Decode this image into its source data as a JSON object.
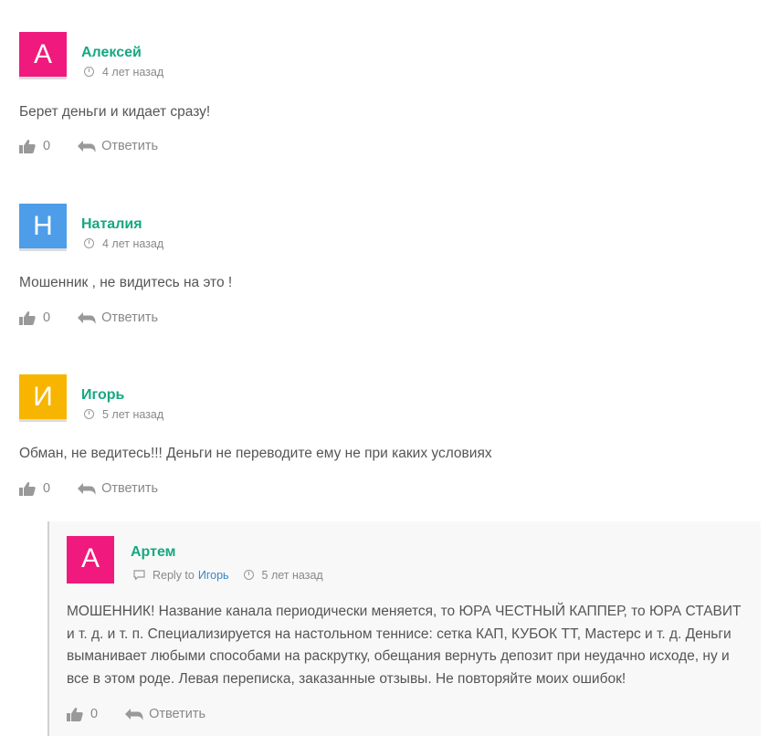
{
  "comments": [
    {
      "avatar_letter": "А",
      "avatar_color": "#f0197d",
      "author": "Алексей",
      "time": "4 лет назад",
      "text": "Берет деньги и кидает сразу!",
      "likes": "0",
      "reply_label": "Ответить"
    },
    {
      "avatar_letter": "Н",
      "avatar_color": "#4d9de8",
      "author": "Наталия",
      "time": "4 лет назад",
      "text": "Мошенник , не видитесь на это !",
      "likes": "0",
      "reply_label": "Ответить"
    },
    {
      "avatar_letter": "И",
      "avatar_color": "#f7b500",
      "author": "Игорь",
      "time": "5 лет назад",
      "text": "Обман, не ведитесь!!! Деньги не переводите ему не при каких условиях",
      "likes": "0",
      "reply_label": "Ответить"
    }
  ],
  "reply": {
    "avatar_letter": "А",
    "avatar_color": "#f0197d",
    "author": "Артем",
    "reply_to_label": "Reply to",
    "reply_to_name": "Игорь",
    "time": "5 лет назад",
    "text": "МОШЕННИК! Название канала периодически меняется, то ЮРА ЧЕСТНЫЙ КАППЕР, то ЮРА СТАВИТ и т. д. и т. п. Специализируется на настольном теннисе: сетка КАП, КУБОК ТТ, Мастерс и т. д. Деньги выманивает любыми способами на раскрутку, обещания вернуть депозит при неудачно исходе, ну и все в этом роде. Левая переписка, заказанные отзывы. Не повторяйте моих ошибок!",
    "likes": "0",
    "reply_label": "Ответить"
  },
  "colors": {
    "author_name": "#16a881",
    "link": "#3a86c4",
    "muted_text": "#888888"
  },
  "icons": [
    "thumbs-up-icon",
    "reply-arrow-icon",
    "clock-icon",
    "chat-bubble-icon"
  ]
}
